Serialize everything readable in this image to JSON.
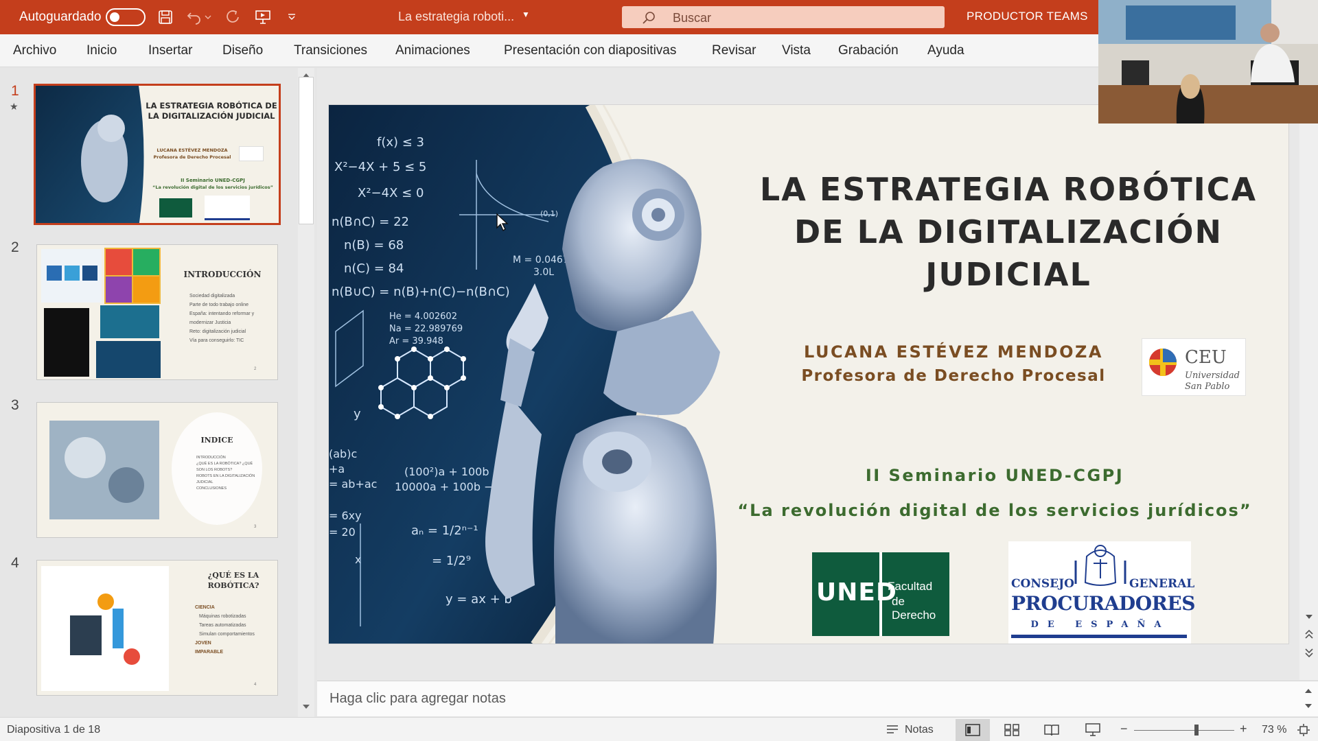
{
  "titlebar": {
    "autosave_label": "Autoguardado",
    "doc_title": "La estrategia roboti...",
    "search_placeholder": "Buscar",
    "user_name": "PRODUCTOR TEAMS"
  },
  "menu": [
    "Archivo",
    "Inicio",
    "Insertar",
    "Diseño",
    "Transiciones",
    "Animaciones",
    "Presentación con diapositivas",
    "Revisar",
    "Vista",
    "Grabación",
    "Ayuda"
  ],
  "thumbnails": [
    {
      "num": "1",
      "title": "LA ESTRATEGIA ROBÓTICA DE LA DIGITALIZACIÓN JUDICIAL",
      "author": "LUCANA ESTÉVEZ MENDOZA",
      "role": "Profesora de Derecho Procesal",
      "seminar": "II Seminario UNED-CGPJ",
      "subtitle": "“La revolución digital de los servicios jurídicos”"
    },
    {
      "num": "2",
      "title": "INTRODUCCIÓN",
      "bullets": [
        "Sociedad digitalizada",
        "Parte de todo trabajo online",
        "España: intentando reformar y modernizar Justicia",
        "Reto: digitalización judicial",
        "Vía para conseguirlo: TIC"
      ],
      "page": "2"
    },
    {
      "num": "3",
      "title": "INDICE",
      "bullets": [
        "INTRODUCCIÓN",
        "¿QUÉ ES LA ROBÓTICA? ¿QUÉ SON LOS ROBOTS?",
        "ROBOTS EN LA DIGITALIZACIÓN JUDICIAL",
        "CONCLUSIONES"
      ],
      "page": "3"
    },
    {
      "num": "4",
      "title": "¿QUÉ ES LA ROBÓTICA?",
      "bullets": [
        "CIENCIA",
        "Máquinas robotizadas",
        "Tareas automatizadas",
        "Simulan comportamientos",
        "JOVEN",
        "IMPARABLE"
      ],
      "page": "4"
    }
  ],
  "slide": {
    "title_lines": [
      "LA ESTRATEGIA ROBÓTICA",
      "DE LA DIGITALIZACIÓN",
      "JUDICIAL"
    ],
    "author": "LUCANA ESTÉVEZ MENDOZA",
    "role": "Profesora de Derecho Procesal",
    "seminar": "II Seminario UNED-CGPJ",
    "subtitle": "“La revolución digital de los servicios jurídicos”",
    "ceu_logo": {
      "name": "CEU",
      "line1": "Universidad",
      "line2": "San Pablo"
    },
    "uned_logo": {
      "name": "UNED",
      "line1": "Facultad",
      "line2": "de Derecho"
    },
    "cgpe_logo": {
      "line1": "CONSEJO",
      "line1b": "GENERAL",
      "line2": "PROCURADORES",
      "line3": "DE ESPAÑA"
    },
    "formulas": [
      "f(x) ≤ 3",
      "X²−4X + 5 ≤ 5",
      "X²−4X ≤ 0",
      "n(B∩C) = 22",
      "n(B) = 68",
      "n(C) = 84",
      "n(B∪C) = n(B)+n(C)−n(B∩C)",
      "He = 4.002602",
      "Na = 22.989769",
      "Ar = 39.948",
      "(100²)a + 100b",
      "10000a + 100b − 5",
      "aₙ = 1/2ⁿ⁻¹",
      "= 1/2⁹",
      "y = ax + b",
      "M = 0.046765",
      "3.0L",
      "(0,1)",
      "y",
      "(ab)c",
      "+a",
      "= ab+ac",
      "= 6xy",
      "= 20",
      "x"
    ]
  },
  "notes_placeholder": "Haga clic para agregar notas",
  "status": {
    "slide_info": "Diapositiva 1 de 18",
    "notes_label": "Notas",
    "zoom": "73 %",
    "zoom_fraction": 0.62
  },
  "colors": {
    "accent": "#c43e1c",
    "slide_bg": "#f3f1ea",
    "title": "#2a2a2a",
    "author": "#7a4d22",
    "seminar": "#3c6b2f",
    "uned": "#0f5b3d",
    "cgpe": "#1f3d8f"
  }
}
